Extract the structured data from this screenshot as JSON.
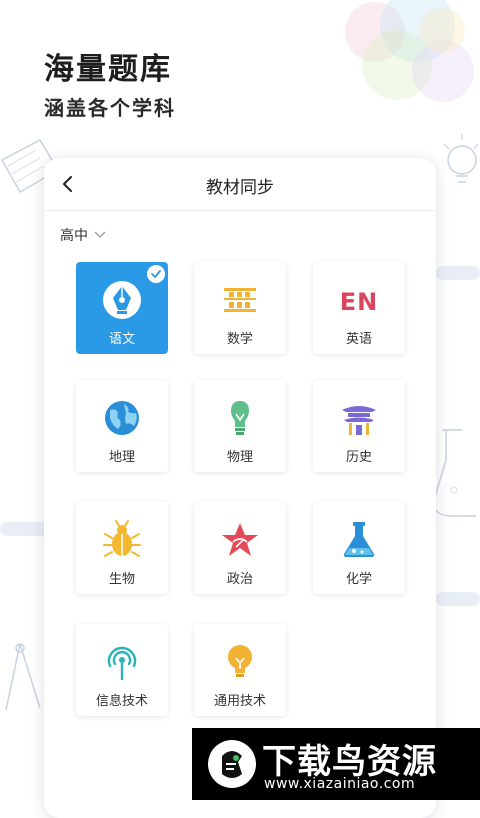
{
  "promo": {
    "headline": "海量题库",
    "subline": "涵盖各个学科"
  },
  "screen": {
    "title": "教材同步",
    "grade_selector": "高中",
    "subjects": [
      {
        "label": "语文",
        "icon": "fountain-pen-icon",
        "selected": true
      },
      {
        "label": "数学",
        "icon": "abacus-icon",
        "selected": false
      },
      {
        "label": "英语",
        "icon": "en-text-icon",
        "icon_text": "EN",
        "selected": false
      },
      {
        "label": "地理",
        "icon": "globe-icon",
        "selected": false
      },
      {
        "label": "物理",
        "icon": "bulb-icon",
        "selected": false
      },
      {
        "label": "历史",
        "icon": "pavilion-icon",
        "selected": false
      },
      {
        "label": "生物",
        "icon": "beetle-icon",
        "selected": false
      },
      {
        "label": "政治",
        "icon": "star-icon",
        "selected": false
      },
      {
        "label": "化学",
        "icon": "flask-icon",
        "selected": false
      },
      {
        "label": "信息技术",
        "icon": "antenna-icon",
        "selected": false
      },
      {
        "label": "通用技术",
        "icon": "lightbulb-icon",
        "selected": false
      }
    ]
  },
  "watermark": {
    "title": "下载鸟资源",
    "url": "www.xiazainiao.com"
  },
  "colors": {
    "selected": "#2b9ae6",
    "math": "#f2b233",
    "english": "#d9465e",
    "geo": "#2b8fd8",
    "physics": "#5fbf8a",
    "history": "#7a6ad8",
    "bio": "#f3b830",
    "politics": "#e24a5a",
    "chem": "#2b8fd8",
    "it": "#2bb3b8",
    "tech": "#f2b233"
  }
}
